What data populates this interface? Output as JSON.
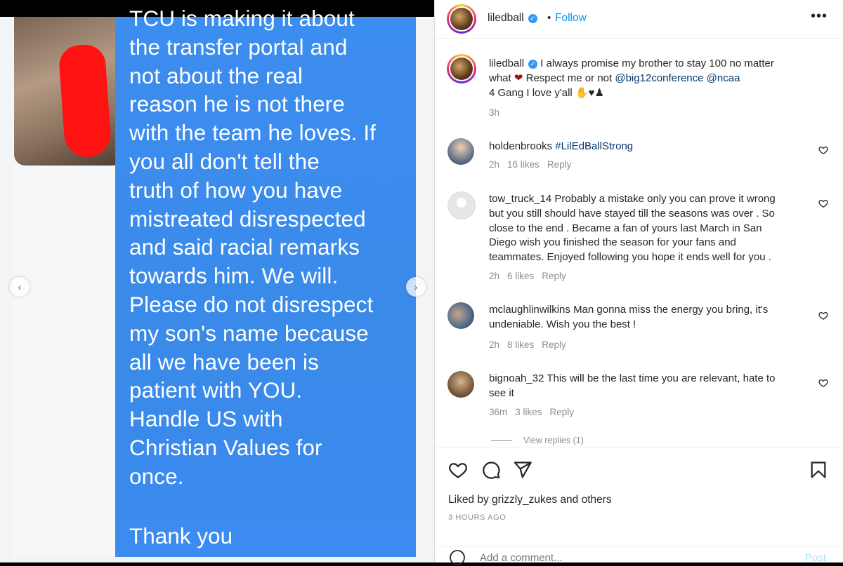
{
  "media": {
    "message_lines": [
      "TCU is making it about",
      "the transfer portal and",
      "not about the real",
      "reason he is not there",
      "with the team he loves. If",
      "you all don't tell the",
      "truth of how you have",
      "mistreated disrespected",
      "and said racial remarks",
      "towards him. We will.",
      "Please do not disrespect",
      "my son's name because",
      "all we have been is",
      "patient with YOU.",
      "Handle US with",
      "Christian Values for",
      "once."
    ],
    "closing": "Thank you",
    "prev_icon": "chevron-left-icon",
    "next_icon": "chevron-right-icon"
  },
  "header": {
    "username": "liledball",
    "separator": "•",
    "follow_label": "Follow",
    "more_label": "•••"
  },
  "caption": {
    "username": "liledball",
    "text_1": "I always promise my brother to stay 100 no matter",
    "text_2a": "what",
    "text_2b": "Respect me or not",
    "mention_1": "@big12conference",
    "mention_2": "@ncaa",
    "text_3": "4 Gang I love y'all",
    "time": "3h"
  },
  "comments": [
    {
      "username": "holdenbrooks",
      "tag": "#LilEdBallStrong",
      "lines": [],
      "time": "2h",
      "likes": "16 likes",
      "reply": "Reply"
    },
    {
      "username": "tow_truck_14",
      "first": "Probably a mistake only you can prove it wrong",
      "lines": [
        "but you still should have stayed till the seasons was over . So",
        "close to the end . Became a fan of yours last March in San",
        "Diego wish you finished the season for your fans and",
        "teammates. Enjoyed following you hope it ends well for you ."
      ],
      "time": "2h",
      "likes": "6 likes",
      "reply": "Reply"
    },
    {
      "username": "mclaughlinwilkins",
      "first": "Man gonna miss the energy you bring, it's",
      "lines": [
        "undeniable. Wish you the best !"
      ],
      "time": "2h",
      "likes": "8 likes",
      "reply": "Reply"
    },
    {
      "username": "bignoah_32",
      "first": "This will be the last time you are relevant, hate to",
      "lines": [
        "see it"
      ],
      "time": "36m",
      "likes": "3 likes",
      "reply": "Reply"
    }
  ],
  "view_replies": "View replies (1)",
  "footer": {
    "liked_prefix": "Liked by",
    "liked_user": "grizzly_zukes",
    "liked_and": "and",
    "liked_others": "others",
    "timestamp": "3 HOURS AGO",
    "comment_placeholder": "Add a comment...",
    "post_label": "Post"
  }
}
